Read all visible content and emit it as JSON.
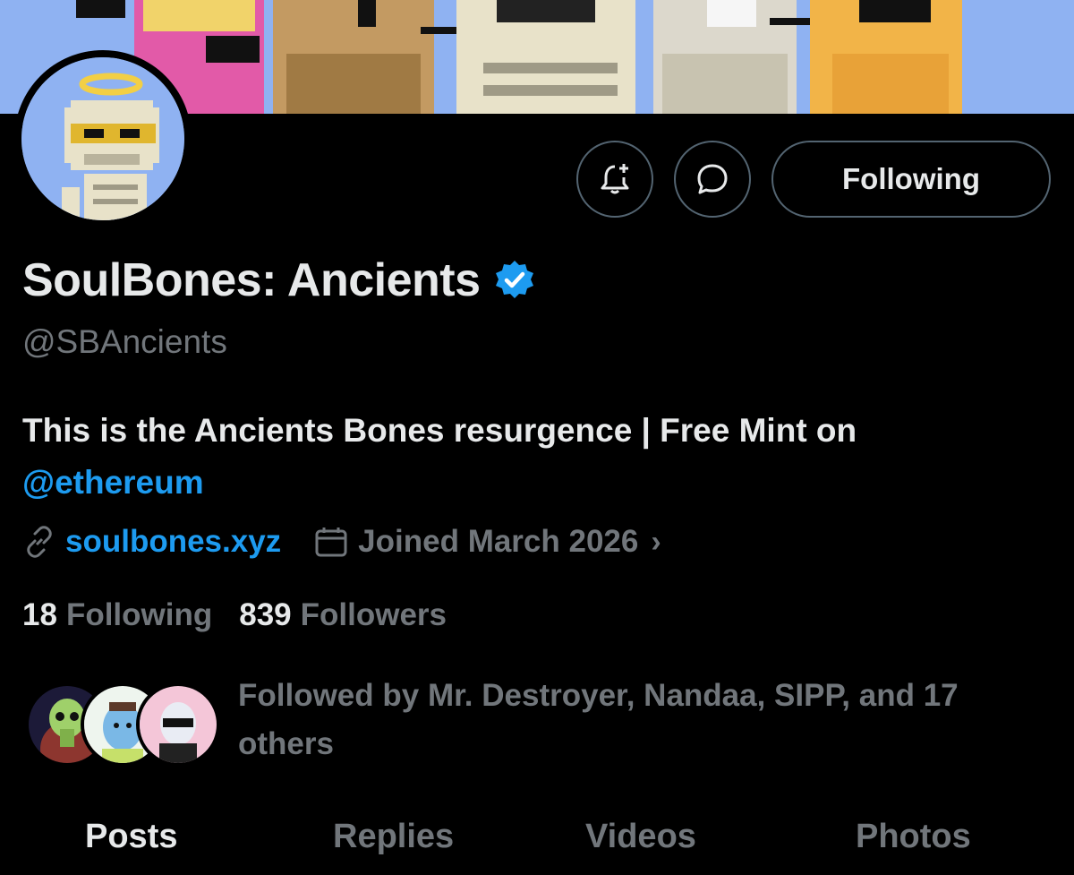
{
  "profile": {
    "display_name": "SoulBones: Ancients",
    "handle": "@SBAncients",
    "bio_text": "This is the Ancients Bones resurgence | Free Mint on ",
    "bio_mention": "@ethereum",
    "website": "soulbones.xyz",
    "joined": "Joined March 2026",
    "following_count": "18",
    "following_label": "Following",
    "followers_count": "839",
    "followers_label": "Followers",
    "followed_by_text": "Followed by Mr. Destroyer, Nandaa, SIPP, and 17 others"
  },
  "actions": {
    "notify_icon": "bell-plus-icon",
    "message_icon": "message-bubble-icon",
    "follow_state_label": "Following"
  },
  "tabs": [
    {
      "label": "Posts",
      "active": true
    },
    {
      "label": "Replies",
      "active": false
    },
    {
      "label": "Videos",
      "active": false
    },
    {
      "label": "Photos",
      "active": false
    }
  ],
  "colors": {
    "background": "#000000",
    "accent_link": "#1d9bf0",
    "muted_text": "#71767b",
    "primary_text": "#e7e9ea",
    "banner_sky": "#8fb2f2",
    "verified_badge": "#1d9bf0"
  }
}
